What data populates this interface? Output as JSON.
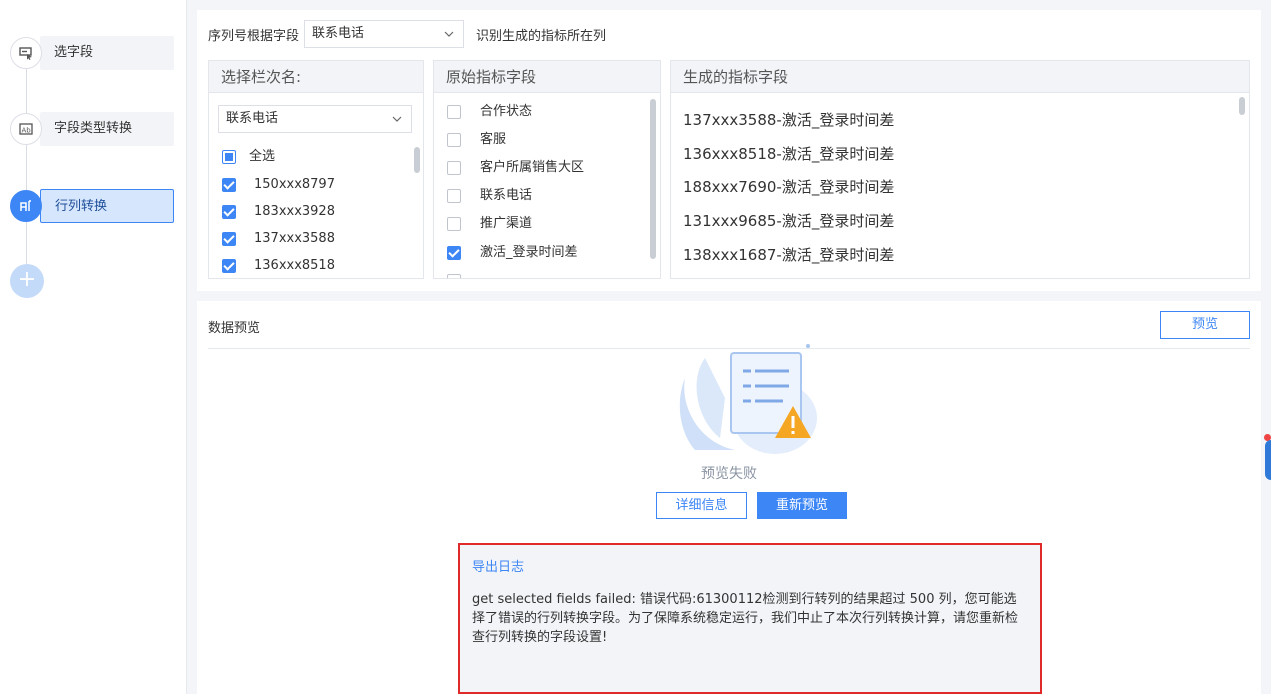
{
  "steps": [
    {
      "label": "选字段",
      "icon": "select-field-icon",
      "active": false
    },
    {
      "label": "字段类型转换",
      "icon": "type-convert-icon",
      "active": false
    },
    {
      "label": "行列转换",
      "icon": "row-column-icon",
      "active": true
    }
  ],
  "add_step_symbol": "+",
  "config": {
    "serial_label": "序列号根据字段",
    "serial_field_value": "联系电话",
    "serial_hint": "识别生成的指标所在列",
    "col1": {
      "header": "选择栏次名:",
      "dropdown_value": "联系电话",
      "select_all": "全选",
      "items": [
        "150xxx8797",
        "183xxx3928",
        "137xxx3588",
        "136xxx8518"
      ]
    },
    "col2": {
      "header": "原始指标字段",
      "items": [
        {
          "label": "合作状态",
          "checked": false
        },
        {
          "label": "客服",
          "checked": false
        },
        {
          "label": "客户所属销售大区",
          "checked": false
        },
        {
          "label": "联系电话",
          "checked": false
        },
        {
          "label": "推广渠道",
          "checked": false
        },
        {
          "label": "激活_登录时间差",
          "checked": true
        }
      ]
    },
    "col3": {
      "header": "生成的指标字段",
      "items": [
        "137xxx3588-激活_登录时间差",
        "136xxx8518-激活_登录时间差",
        "188xxx7690-激活_登录时间差",
        "131xxx9685-激活_登录时间差",
        "138xxx1687-激活_登录时间差"
      ]
    }
  },
  "preview": {
    "title": "数据预览",
    "preview_button": "预览",
    "fail_text": "预览失败",
    "detail_button": "详细信息",
    "retry_button": "重新预览",
    "log_title": "导出日志",
    "log_message": "get selected fields failed: 错误代码:61300112检测到行转列的结果超过 500 列，您可能选择了错误的行列转换字段。为了保障系统稳定运行，我们中止了本次行列转换计算，请您重新检查行列转换的字段设置!"
  },
  "colors": {
    "accent": "#3d86f5",
    "error_border": "#e02a2a",
    "active_step_bg": "#d6e6fd"
  }
}
